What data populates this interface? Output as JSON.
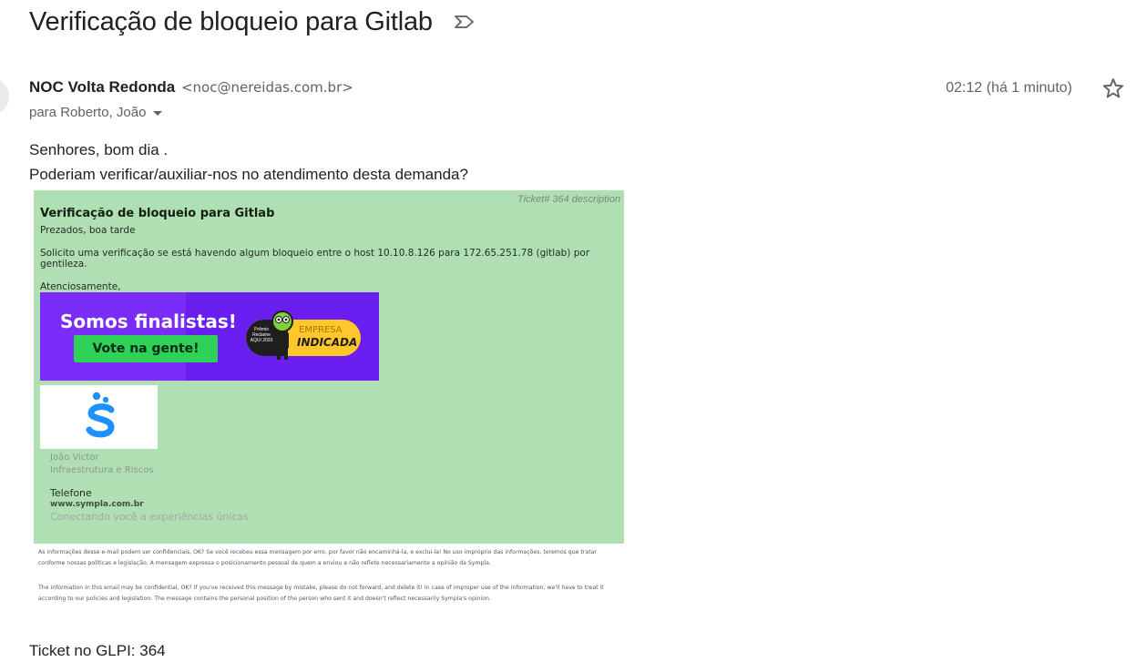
{
  "email": {
    "subject": "Verificação de bloqueio para Gitlab",
    "sender_name": "NOC Volta Redonda",
    "sender_email": "<noc@nereidas.com.br>",
    "recipients": "para Roberto, João",
    "time": "02:12 (há 1 minuto)",
    "body_lines": [
      "Senhores, bom dia .",
      "Poderiam verificar/auxiliar-nos no atendimento desta demanda?"
    ],
    "footer": "Ticket no GLPI: 364"
  },
  "ticket_card": {
    "label": "Ticket# 364 description",
    "title": "Verificação de bloqueio para Gitlab",
    "greeting": "Prezados, boa tarde",
    "request_line1": "Solicito uma verificação se está havendo algum bloqueio entre o host 10.10.8.126 para 172.65.251.78 (gitlab) por",
    "request_line2": "gentileza.",
    "closing": "Atenciosamente,",
    "banner": {
      "headline": "Somos finalistas!",
      "button": "Vote na gente!",
      "badge_small": "Prêmio Reclame AQUI 2020",
      "badge_empresa": "EMPRESA",
      "badge_indicada": "INDICADA"
    },
    "signature": {
      "name": "João Victor",
      "department": "Infraestrutura e Riscos",
      "phone_label": "Telefone",
      "website": "www.sympla.com.br",
      "tagline": "Conectando você a experiências únicas"
    },
    "disclaimer_pt_1": "As informações desse e-mail podem ser confidenciais, OK? Se você recebeu essa mensagem por erro, por favor não encaminhá-la, e exclui-la! No uso impróprio das informações, teremos que tratar",
    "disclaimer_pt_2": "conforme nossas políticas e legislação. A mensagem expressa o posicionamento pessoal de quem a enviou e não reflete necessariamente a opinião da Sympla.",
    "disclaimer_en_1": "The information in this email may be confidential, OK? If you've received this message by mistake, please do not forward, and delete it! In case of improper use of the information, we'll have to treat it",
    "disclaimer_en_2": "according to our policies and legislation. The message contains the personal position of the person who sent it and doesn't reflect necessarily Sympla's opinion."
  },
  "icons": {
    "importance": "importance-marker-icon",
    "star": "star-icon",
    "caret": "chevron-down-icon"
  },
  "colors": {
    "ticket_bg": "#b1dfb4",
    "banner_bg": "#6a1ff0",
    "vote_button": "#30d158",
    "badge": "#ffc72a",
    "sympla_blue": "#1e90ff"
  }
}
